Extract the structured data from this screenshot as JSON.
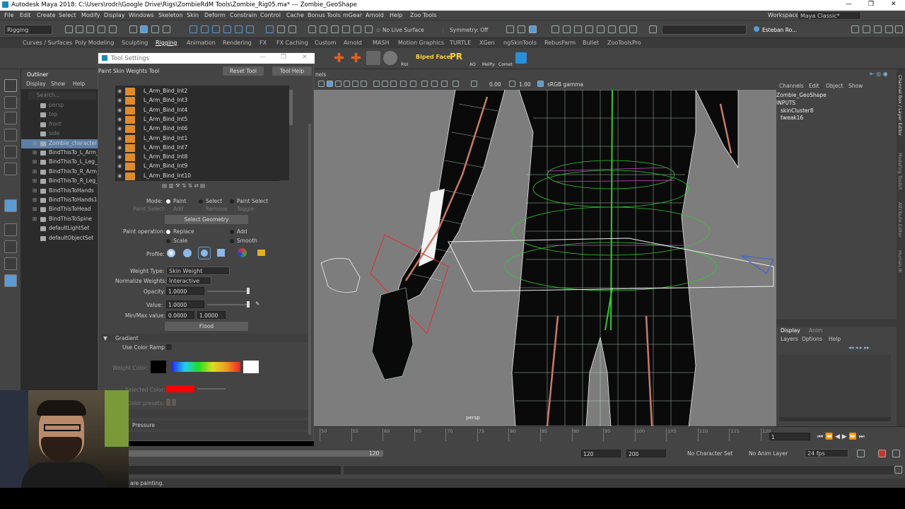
{
  "titlebar": {
    "title": "Autodesk Maya 2018: C:\\Users\\rodri\\Google Drive\\Rigs\\ZombieRdM Tools\\Zombie_Rig05.ma*   ---   Zombie_GeoShape",
    "min": "—",
    "max": "❐",
    "close": "✕"
  },
  "menus": [
    "File",
    "Edit",
    "Create",
    "Select",
    "Modify",
    "Display",
    "Windows",
    "Skeleton",
    "Skin",
    "Deform",
    "Constrain",
    "Control",
    "Cache",
    "Bonus Tools",
    "mGear",
    "Arnold",
    "Help",
    "Zoo Tools"
  ],
  "workspace": {
    "label": "Workspace :",
    "value": "Maya Classic*"
  },
  "status": {
    "menu_set": "Rigging",
    "live_surface": "No Live Surface",
    "symmetry": "Symmetry: Off",
    "user": "Esteban Ro..."
  },
  "shelf_tabs": [
    "Curves / Surfaces",
    "Poly Modeling",
    "Sculpting",
    "Rigging",
    "Animation",
    "Rendering",
    "FX",
    "FX Caching",
    "Custom",
    "Arnold",
    "MASH",
    "Motion Graphics",
    "TURTLE",
    "XGen",
    "ngSkinTools",
    "RebusFarm",
    "Bullet",
    "ZooToolsPro"
  ],
  "shelf_labels": {
    "biped": "Biped Face",
    "pr": "PR",
    "rui": "RUI",
    "ao": "AO",
    "melpy": "MelPy",
    "comet": "Comet"
  },
  "outliner": {
    "title": "Outliner",
    "menu": [
      "Display",
      "Show",
      "Help"
    ],
    "search": "Search...",
    "items": [
      "persp",
      "top",
      "front",
      "side",
      "Zombie_character",
      "BindThisTo_L_Arm_F",
      "BindThisTo_L_Leg_R",
      "BindThisTo_R_Arm_F",
      "BindThisTo_R_Leg_R",
      "BindThisToHands",
      "BindThisToHands1",
      "BindThisToHead",
      "BindThisToSpine",
      "defaultLightSet",
      "defaultObjectSet"
    ]
  },
  "tool_settings": {
    "window_title": "Tool Settings",
    "tool_name": "Paint Skin Weights Tool",
    "reset": "Reset Tool",
    "help": "Tool Help",
    "joints": [
      "L_Arm_Bind_Int2",
      "L_Arm_Bind_Int3",
      "L_Arm_Bind_Int4",
      "L_Arm_Bind_Int5",
      "L_Arm_Bind_Int6",
      "L_Arm_Bind_Int1",
      "L_Arm_Bind_Int7",
      "L_Arm_Bind_Int8",
      "L_Arm_Bind_Int9",
      "L_Arm_Bind_Int10"
    ],
    "mode_label": "Mode:",
    "mode_opts": [
      "Paint",
      "Select",
      "Paint Select"
    ],
    "paint_select_label": "Paint Select:",
    "paint_select_opts": [
      "Add",
      "Remove",
      "Toggle"
    ],
    "select_geometry": "Select Geometry",
    "paint_op_label": "Paint operation:",
    "paint_ops": [
      "Replace",
      "Add",
      "Scale",
      "Smooth"
    ],
    "profile_label": "Profile:",
    "weight_type_label": "Weight Type:",
    "weight_type": "Skin Weight",
    "normalize_label": "Normalize Weights:",
    "normalize": "Interactive",
    "opacity_label": "Opacity:",
    "opacity": "1.0000",
    "value_label": "Value:",
    "value": "1.0000",
    "minmax_label": "Min/Max value:",
    "min": "0.0000",
    "max": "1.0000",
    "flood": "Flood",
    "gradient": "Gradient",
    "use_color_ramp": "Use Color Ramp",
    "weight_color": "Weight Color:",
    "selected_color": "Selected Color:",
    "color_presets": "Color presets:",
    "pressure": "Pressure"
  },
  "viewport": {
    "panel_menu": "nels",
    "exposure": "0.00",
    "gamma": "1.00",
    "color_space": "sRGB gamma",
    "camera": "persp"
  },
  "channel_box": {
    "menu": [
      "Channels",
      "Edit",
      "Object",
      "Show"
    ],
    "object": "Zombie_GeoShape",
    "inputs": "INPUTS",
    "input_items": [
      "skinCluster8",
      "tweak16"
    ],
    "layer_tabs": [
      "Display",
      "Anim"
    ],
    "layer_menu": [
      "Layers",
      "Options",
      "Help"
    ],
    "side_tabs": [
      "Channel Box / Layer Editor",
      "Modeling Toolkit",
      "Attribute Editor",
      "Human IK"
    ]
  },
  "timeline": {
    "ticks": [
      "50",
      "55",
      "60",
      "65",
      "70",
      "75",
      "80",
      "85",
      "90",
      "95",
      "100",
      "105",
      "110",
      "115",
      "120"
    ],
    "current": "1"
  },
  "range": {
    "end_inner": "120",
    "start": "120",
    "end": "200",
    "char_set": "No Character Set",
    "anim_layer": "No Anim Layer",
    "fps": "24 fps"
  },
  "helpline": "are painting.",
  "colors": {
    "joint_swatch": "#e08a2c",
    "selected_color": "#ff0000",
    "accent": "#5b9bd5"
  }
}
